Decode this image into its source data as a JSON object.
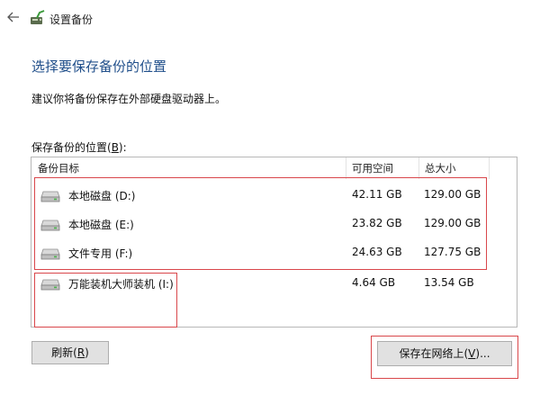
{
  "window": {
    "title": "设置备份"
  },
  "icons": {
    "back": "back-arrow-icon",
    "app": "backup-app-icon",
    "drive": "hard-drive-icon"
  },
  "page": {
    "heading": "选择要保存备份的位置",
    "description": "建议你将备份保存在外部硬盘驱动器上。",
    "list_label_prefix": "保存备份的位置(",
    "list_label_key": "B",
    "list_label_suffix": "):"
  },
  "table": {
    "columns": [
      "备份目标",
      "可用空间",
      "总大小"
    ],
    "rows": [
      {
        "name": "本地磁盘 (D:)",
        "free": "42.11 GB",
        "total": "129.00 GB"
      },
      {
        "name": "本地磁盘 (E:)",
        "free": "23.82 GB",
        "total": "129.00 GB"
      },
      {
        "name": "文件专用 (F:)",
        "free": "24.63 GB",
        "total": "127.75 GB"
      },
      {
        "name": "万能装机大师装机 (I:)",
        "free": "4.64 GB",
        "total": "13.54 GB"
      }
    ]
  },
  "buttons": {
    "refresh_prefix": "刷新(",
    "refresh_key": "R",
    "refresh_suffix": ")",
    "network_prefix": "保存在网络上(",
    "network_key": "V",
    "network_suffix": ")..."
  },
  "colors": {
    "heading": "#1f4e8a",
    "highlight": "#d9474b",
    "button": "#e1e1e1"
  }
}
